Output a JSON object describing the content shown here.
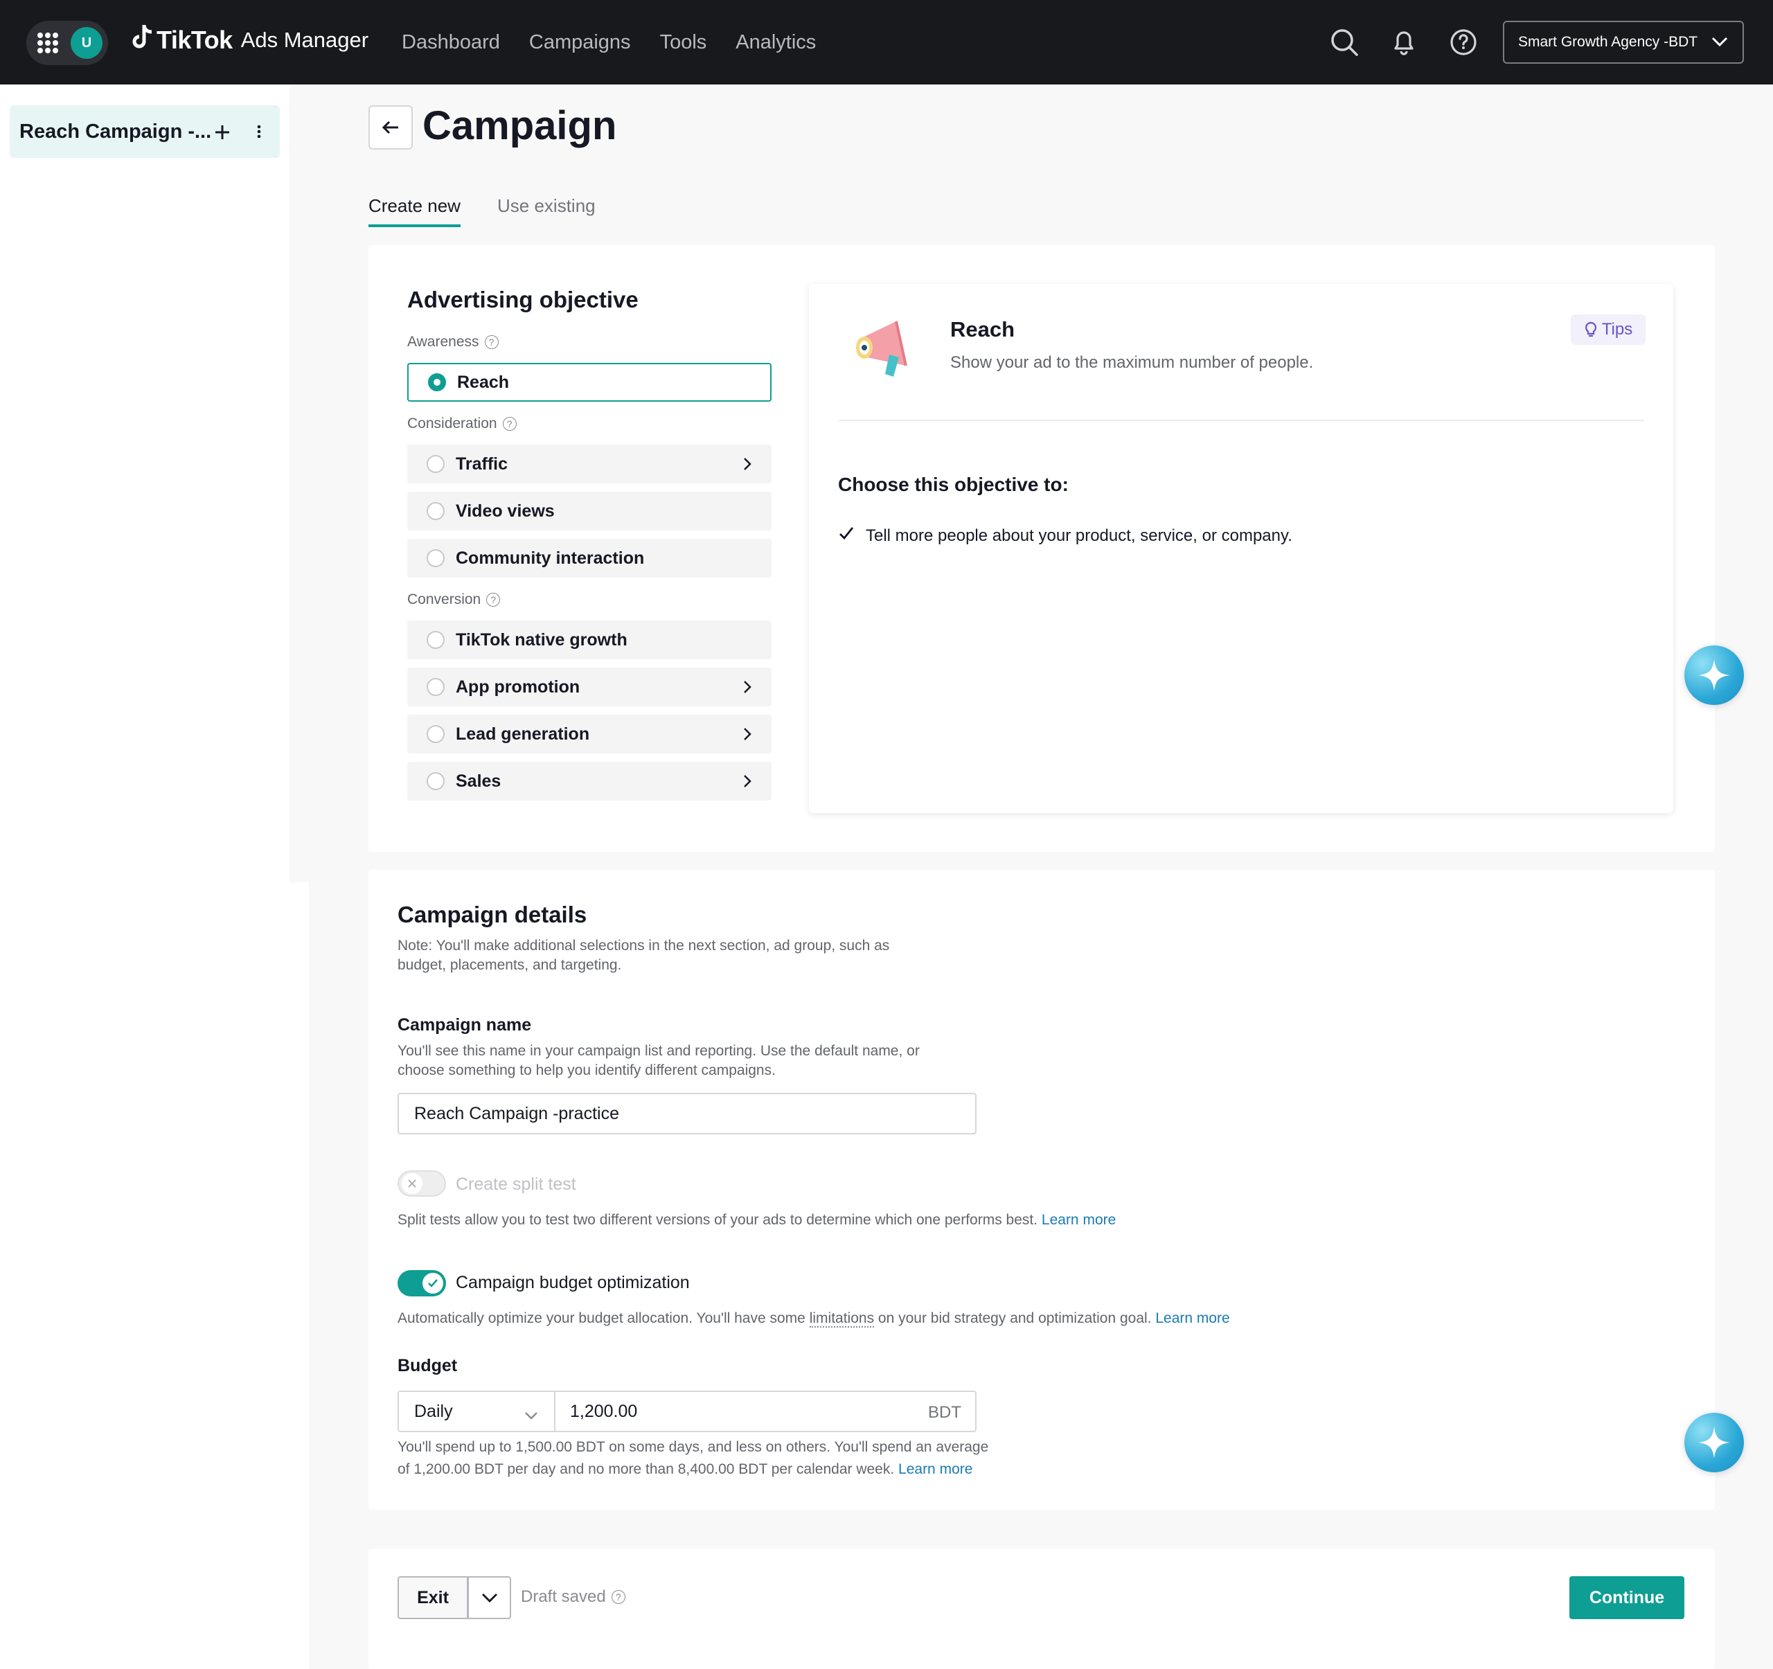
{
  "topbar": {
    "avatar_initial": "U",
    "logo_brand": "TikTok",
    "logo_sub": "Ads Manager",
    "nav": [
      "Dashboard",
      "Campaigns",
      "Tools",
      "Analytics"
    ],
    "icons": [
      "search-icon",
      "bell-icon",
      "help-icon"
    ],
    "account": "Smart Growth Agency -BDT"
  },
  "sidebar": {
    "campaign_label": "Reach Campaign -..."
  },
  "header": {
    "title": "Campaign",
    "tabs": [
      "Create new",
      "Use existing"
    ],
    "active_tab": "Create new"
  },
  "objective": {
    "title": "Advertising objective",
    "groups": {
      "awareness": "Awareness",
      "consideration": "Consideration",
      "conversion": "Conversion"
    },
    "options": {
      "reach": "Reach",
      "traffic": "Traffic",
      "video_views": "Video views",
      "community_interaction": "Community interaction",
      "native_growth": "TikTok native growth",
      "app_promotion": "App promotion",
      "lead_generation": "Lead generation",
      "sales": "Sales"
    },
    "selected": "Reach",
    "panel": {
      "title": "Reach",
      "description": "Show your ad to the maximum number of people.",
      "tips": "Tips",
      "choose_title": "Choose this objective to:",
      "bullet": "Tell more people about your product, service, or company."
    }
  },
  "details": {
    "title": "Campaign details",
    "note_line1": "Note: You'll make additional selections in the next section, ad group, such as",
    "note_line2": "budget, placements, and targeting.",
    "name_title": "Campaign name",
    "name_note_line1": "You'll see this name in your campaign list and reporting. Use the default name, or",
    "name_note_line2": "choose something to help you identify different campaigns.",
    "name_value": "Reach Campaign -practice",
    "split_test_label": "Create split test",
    "split_test_enabled": false,
    "split_test_note": "Split tests allow you to test two different versions of your ads to determine which one performs best.",
    "learn_more": "Learn more",
    "cbo_label": "Campaign budget optimization",
    "cbo_enabled": true,
    "cbo_note_before": "Automatically optimize your budget allocation. You'll have some",
    "cbo_note_link": "limitations",
    "cbo_note_after": "on your bid strategy and optimization goal.",
    "budget_title": "Budget",
    "budget_type": "Daily",
    "budget_value": "1,200.00",
    "budget_currency": "BDT",
    "budget_note_line1": "You'll spend up to 1,500.00 BDT on some days, and less on others. You'll spend an average",
    "budget_note_line2": "of 1,200.00 BDT per day and no more than 8,400.00 BDT per calendar week."
  },
  "footer": {
    "exit": "Exit",
    "draft": "Draft saved",
    "continue": "Continue"
  },
  "colors": {
    "accent": "#0e9e93",
    "topbar": "#18191c",
    "link": "#1a7bb0",
    "tips": "#6b52c9"
  }
}
